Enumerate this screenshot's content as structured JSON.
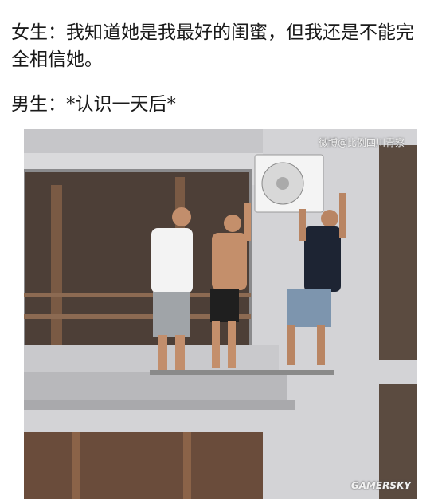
{
  "meme": {
    "line1": "女生：我知道她是我最好的闺蜜，但我还是不能完全相信她。",
    "line2": "男生：*认识一天后*"
  },
  "watermarks": {
    "top": "微博@比例四川青察",
    "bottom": "GAMERSKY"
  },
  "colors": {
    "wall": "#d6d6d8",
    "window": "#5a4a40",
    "ledge": "#bdbdc0"
  }
}
